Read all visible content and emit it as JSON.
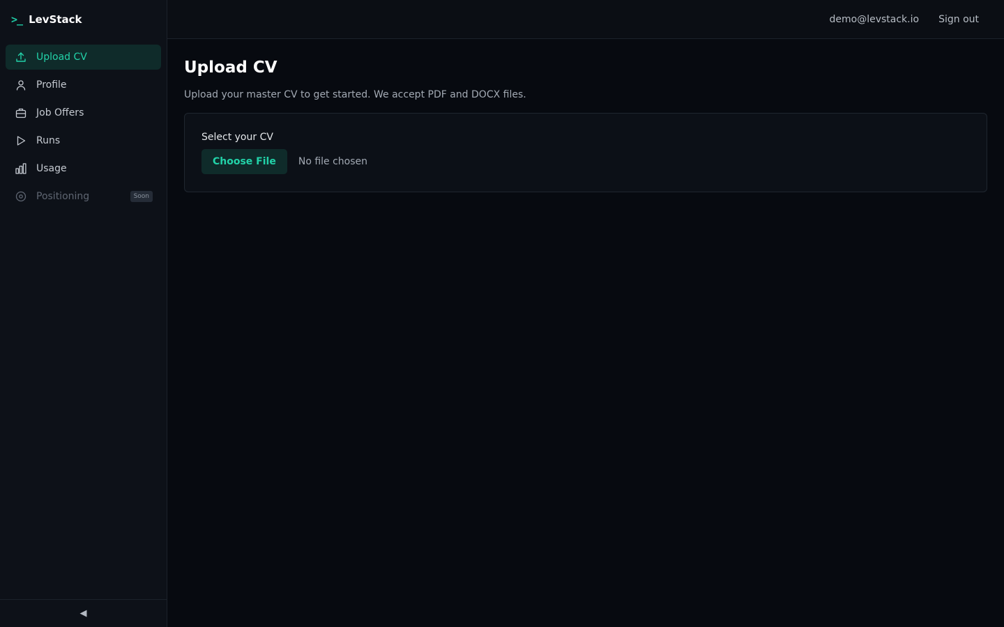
{
  "brand": {
    "mark": ">_",
    "name": "LevStack"
  },
  "sidebar": {
    "items": [
      {
        "label": "Upload CV",
        "icon": "upload-icon"
      },
      {
        "label": "Profile",
        "icon": "user-icon"
      },
      {
        "label": "Job Offers",
        "icon": "briefcase-icon"
      },
      {
        "label": "Runs",
        "icon": "play-icon"
      },
      {
        "label": "Usage",
        "icon": "bar-chart-icon"
      },
      {
        "label": "Positioning",
        "icon": "target-icon",
        "badge": "Soon"
      }
    ],
    "collapse_glyph": "◀"
  },
  "topbar": {
    "email": "demo@levstack.io",
    "signout_label": "Sign out"
  },
  "main": {
    "title": "Upload CV",
    "description": "Upload your master CV to get started. We accept PDF and DOCX files.",
    "card": {
      "label": "Select your CV",
      "button_label": "Choose File",
      "file_status": "No file chosen"
    }
  },
  "colors": {
    "accent": "#22d3a9",
    "active_bg": "#0f2b2a",
    "background": "#070a10"
  }
}
